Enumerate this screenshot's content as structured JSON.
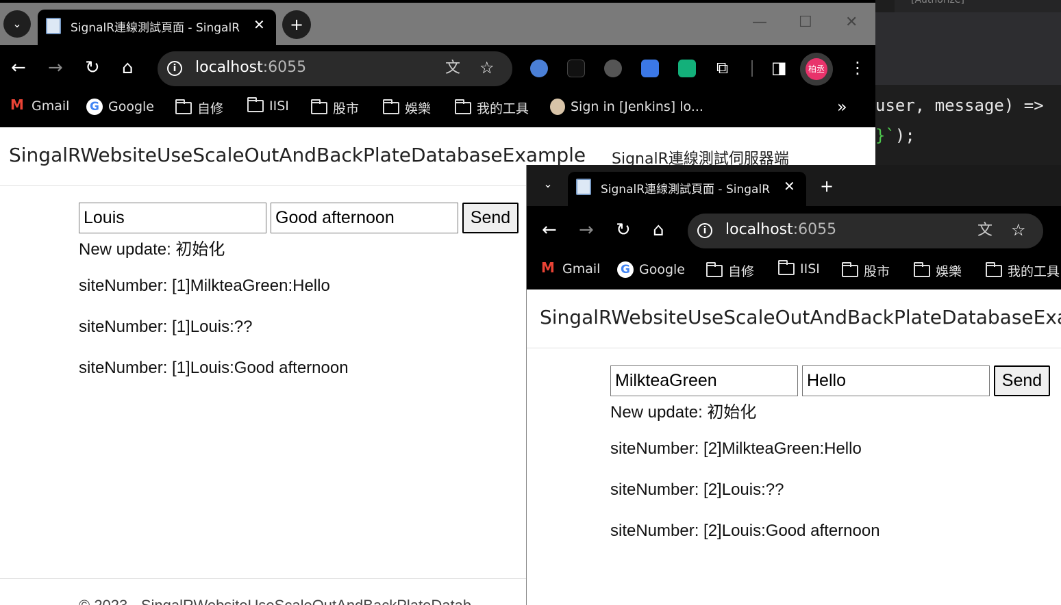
{
  "editor": {
    "tooltip": "[Authorize]",
    "code_line_1": "user, message) =>",
    "code_line_2_brace": "}`",
    "code_line_2_rest": ");"
  },
  "window1": {
    "tab_title": "SignalR連線測試頁面 - SingalR",
    "url_host": "localhost",
    "url_port": ":6055",
    "avatar_text": "柏丞",
    "bookmarks": [
      "Gmail",
      "Google",
      "自修",
      "IISI",
      "股市",
      "娛樂",
      "我的工具",
      "Sign in [Jenkins] lo..."
    ],
    "overflow": "»",
    "brand": "SingalRWebsiteUseScaleOutAndBackPlateDatabaseExample",
    "nav_link": "SignalR連線測試伺服器端",
    "user_value": "Louis",
    "message_value": "Good afternoon",
    "send_label": "Send",
    "status": "New update: 初始化",
    "messages": [
      "siteNumber: [1]MilkteaGreen:Hello",
      "siteNumber: [1]Louis:??",
      "siteNumber: [1]Louis:Good afternoon"
    ],
    "footer": "© 2023 - SingalRWebsiteUseScaleOutAndBackPlateDatab"
  },
  "window2": {
    "tab_title": "SignalR連線測試頁面 - SingalR",
    "url_host": "localhost",
    "url_port": ":6055",
    "bookmarks": [
      "Gmail",
      "Google",
      "自修",
      "IISI",
      "股市",
      "娛樂",
      "我的工具"
    ],
    "brand": "SingalRWebsiteUseScaleOutAndBackPlateDatabaseExa",
    "user_value": "MilkteaGreen",
    "message_value": "Hello",
    "send_label": "Send",
    "status": "New update: 初始化",
    "messages": [
      "siteNumber: [2]MilkteaGreen:Hello",
      "siteNumber: [2]Louis:??",
      "siteNumber: [2]Louis:Good afternoon"
    ]
  },
  "colors": {
    "tabstrip_inactive": "#7a7a7a",
    "chrome_dark": "#000000",
    "omnibox": "#2b2b2b",
    "avatar": "#e8336b"
  },
  "icons": {
    "tab_search": "chevron-down-icon",
    "new_tab": "plus-icon",
    "back": "arrow-left-icon",
    "forward": "arrow-right-icon",
    "reload": "reload-icon",
    "home": "home-icon",
    "translate": "translate-icon",
    "bookmark": "star-icon",
    "extensions": "puzzle-icon",
    "side_panel": "side-panel-icon",
    "menu": "kebab-menu-icon"
  }
}
